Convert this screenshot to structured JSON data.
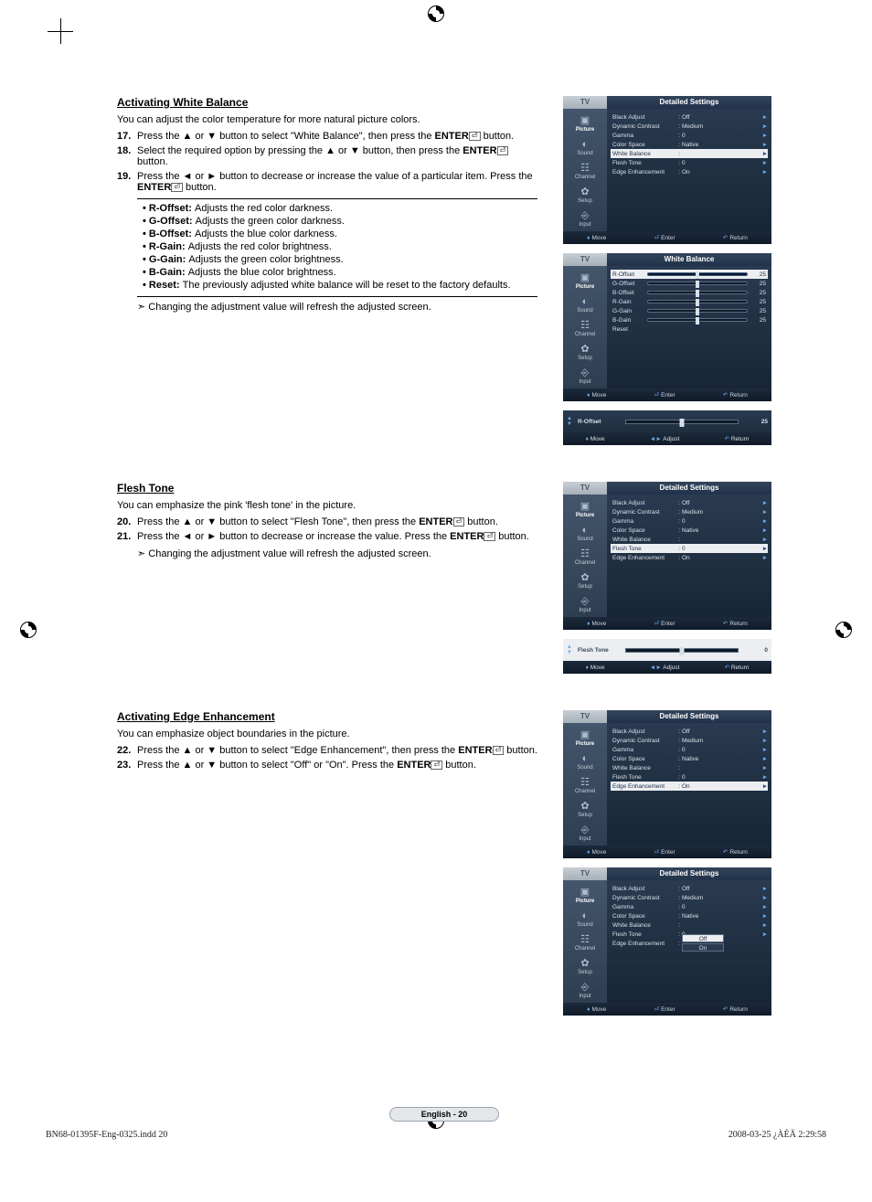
{
  "sections": {
    "wb": {
      "heading": "Activating White Balance",
      "intro": "You can adjust the color temperature for more natural picture colors.",
      "steps": [
        {
          "n": "17.",
          "text_a": "Press the ▲ or ▼ button to select \"White Balance\", then press the ",
          "enter": "ENTER",
          "text_b": " button."
        },
        {
          "n": "18.",
          "text_a": "Select the required option by pressing the ▲ or ▼ button, then press the ",
          "enter": "ENTER",
          "text_b": " button."
        },
        {
          "n": "19.",
          "text_a": "Press the ◄ or ► button to decrease or increase the value of a particular item. Press the ",
          "enter": "ENTER",
          "text_b": " button."
        }
      ],
      "defs": [
        {
          "term": "R-Offset:",
          "desc": "Adjusts the red color darkness."
        },
        {
          "term": "G-Offset:",
          "desc": "Adjusts the green color darkness."
        },
        {
          "term": "B-Offset:",
          "desc": "Adjusts the blue color darkness."
        },
        {
          "term": "R-Gain:",
          "desc": "Adjusts the red color brightness."
        },
        {
          "term": "G-Gain:",
          "desc": "Adjusts the green color brightness."
        },
        {
          "term": "B-Gain:",
          "desc": "Adjusts the blue color brightness."
        },
        {
          "term": "Reset:",
          "desc": "The previously adjusted white balance will be reset to the factory defaults."
        }
      ],
      "note": "Changing the adjustment value will refresh the adjusted screen."
    },
    "ft": {
      "heading": "Flesh Tone",
      "intro": "You can emphasize the pink 'flesh tone' in the picture.",
      "steps": [
        {
          "n": "20.",
          "text_a": "Press the ▲ or ▼ button to select \"Flesh Tone\", then press the ",
          "enter": "ENTER",
          "text_b": " button."
        },
        {
          "n": "21.",
          "text_a": "Press the ◄ or ► button to decrease or increase the value. Press the ",
          "enter": "ENTER",
          "text_b": " button."
        }
      ],
      "note": "Changing the adjustment value will refresh the adjusted screen."
    },
    "ee": {
      "heading": "Activating Edge Enhancement",
      "intro": "You can emphasize object boundaries in the picture.",
      "steps": [
        {
          "n": "22.",
          "text_a": "Press the ▲ or ▼ button to select \"Edge Enhancement\", then press the ",
          "enter": "ENTER",
          "text_b": " button."
        },
        {
          "n": "23.",
          "text_a": "Press the ▲ or ▼ button to select \"Off\" or \"On\". Press the ",
          "enter": "ENTER",
          "text_b": " button."
        }
      ]
    }
  },
  "osd_common": {
    "tv": "TV",
    "sidebar": [
      {
        "icon": "▣",
        "label": "Picture"
      },
      {
        "icon": "◐",
        "label": "Sound"
      },
      {
        "icon": "☷",
        "label": "Channel"
      },
      {
        "icon": "✿",
        "label": "Setup"
      },
      {
        "icon": "⎆",
        "label": "Input"
      }
    ],
    "footer_move": "Move",
    "footer_enter": "Enter",
    "footer_return": "Return",
    "footer_adjust": "Adjust"
  },
  "osd1": {
    "title": "Detailed Settings",
    "rows": [
      {
        "lbl": "Black Adjust",
        "val": "Off"
      },
      {
        "lbl": "Dynamic Contrast",
        "val": "Medium"
      },
      {
        "lbl": "Gamma",
        "val": "0"
      },
      {
        "lbl": "Color Space",
        "val": "Native"
      },
      {
        "lbl": "White Balance",
        "val": "",
        "hl": true
      },
      {
        "lbl": "Flesh Tone",
        "val": "0"
      },
      {
        "lbl": "Edge Enhancement",
        "val": "On"
      }
    ]
  },
  "osd2": {
    "title": "White Balance",
    "rows": [
      {
        "lbl": "R-Offset",
        "num": "25",
        "hl": true
      },
      {
        "lbl": "G-Offset",
        "num": "25"
      },
      {
        "lbl": "B-Offset",
        "num": "25"
      },
      {
        "lbl": "R-Gain",
        "num": "25"
      },
      {
        "lbl": "G-Gain",
        "num": "25"
      },
      {
        "lbl": "B-Gain",
        "num": "25"
      },
      {
        "lbl": "Reset",
        "num": ""
      }
    ]
  },
  "osd2_strip": {
    "name": "R-Offset",
    "value": "25"
  },
  "osd3": {
    "title": "Detailed Settings",
    "rows": [
      {
        "lbl": "Black Adjust",
        "val": "Off"
      },
      {
        "lbl": "Dynamic Contrast",
        "val": "Medium"
      },
      {
        "lbl": "Gamma",
        "val": "0"
      },
      {
        "lbl": "Color Space",
        "val": "Native"
      },
      {
        "lbl": "White Balance",
        "val": ""
      },
      {
        "lbl": "Flesh Tone",
        "val": "0",
        "hl": true
      },
      {
        "lbl": "Edge Enhancement",
        "val": "On"
      }
    ]
  },
  "osd3_strip": {
    "name": "Flesh Tone",
    "value": "0"
  },
  "osd4": {
    "title": "Detailed Settings",
    "rows": [
      {
        "lbl": "Black Adjust",
        "val": "Off"
      },
      {
        "lbl": "Dynamic Contrast",
        "val": "Medium"
      },
      {
        "lbl": "Gamma",
        "val": "0"
      },
      {
        "lbl": "Color Space",
        "val": "Native"
      },
      {
        "lbl": "White Balance",
        "val": ""
      },
      {
        "lbl": "Flesh Tone",
        "val": "0"
      },
      {
        "lbl": "Edge Enhancement",
        "val": "On",
        "hl": true
      }
    ]
  },
  "osd5": {
    "title": "Detailed Settings",
    "rows": [
      {
        "lbl": "Black Adjust",
        "val": "Off"
      },
      {
        "lbl": "Dynamic Contrast",
        "val": "Medium"
      },
      {
        "lbl": "Gamma",
        "val": "0"
      },
      {
        "lbl": "Color Space",
        "val": "Native"
      },
      {
        "lbl": "White Balance",
        "val": ""
      },
      {
        "lbl": "Flesh Tone",
        "val": "0"
      }
    ],
    "dropdown": {
      "lbl": "Edge Enhancement",
      "opts": [
        "Off",
        "On"
      ],
      "sel": "Off"
    }
  },
  "page_tag": "English - 20",
  "printline_left": "BN68-01395F-Eng-0325.indd   20",
  "printline_right": "2008-03-25   ¿ÀÈÄ 2:29:58"
}
